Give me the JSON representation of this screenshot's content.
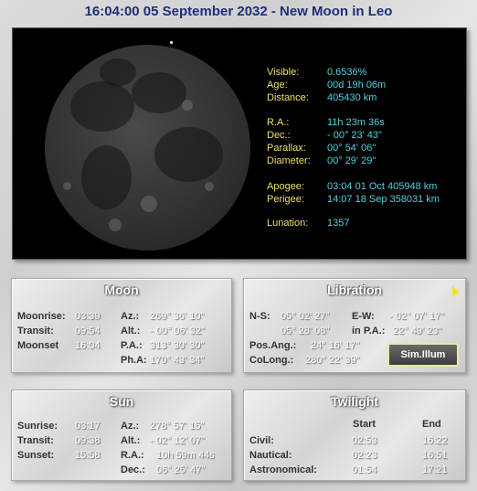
{
  "title": "16:04:00  05 September 2032 - New Moon in Leo",
  "info": [
    {
      "label": "Visible:",
      "value": "0.6536%"
    },
    {
      "label": "Age:",
      "value": "00d 19h 06m"
    },
    {
      "label": "Distance:",
      "value": "405430 km"
    },
    {
      "label": "R.A.:",
      "value": "11h 23m 36s"
    },
    {
      "label": "Dec.:",
      "value": "- 00° 23' 43\""
    },
    {
      "label": "Parallax:",
      "value": "00° 54' 06\""
    },
    {
      "label": "Diameter:",
      "value": "00° 29' 29\""
    },
    {
      "label": "Apogee:",
      "value": "03:04  01 Oct   405948 km"
    },
    {
      "label": "Perigee:",
      "value": "14:07  18 Sep  358031 km"
    },
    {
      "label": "Lunation:",
      "value": "1357"
    }
  ],
  "moon": {
    "title": "Moon",
    "left": [
      {
        "label": "Moonrise:",
        "value": "03:39"
      },
      {
        "label": "Transit:",
        "value": "09:54"
      },
      {
        "label": "Moonset",
        "value": "16:04"
      }
    ],
    "right": [
      {
        "label": "Az.:",
        "value": "269° 36' 10\""
      },
      {
        "label": "Alt.:",
        "value": "- 00° 06' 32\""
      },
      {
        "label": "P.A.:",
        "value": "313° 30' 30\""
      },
      {
        "label": "Ph.A:",
        "value": "170° 43' 34\""
      }
    ]
  },
  "libration": {
    "title": "Libration",
    "ns_label": "N-S:",
    "ns_value": "05° 02' 27\"",
    "ew_label": "E-W:",
    "ew_value": "- 02° 07' 17\"",
    "row2_value": "05° 28' 08\"",
    "inpa_label": "in P.A.:",
    "inpa_value": "22° 49' 23\"",
    "posang_label": "Pos.Ang.:",
    "posang_value": "24° 16' 17\"",
    "colong_label": "CoLong.:",
    "colong_value": "280° 22' 39\"",
    "button": "Sim.Illum"
  },
  "sun": {
    "title": "Sun",
    "left": [
      {
        "label": "Sunrise:",
        "value": "03:17"
      },
      {
        "label": "Transit:",
        "value": "09:38"
      },
      {
        "label": "Sunset:",
        "value": "15:58"
      }
    ],
    "right": [
      {
        "label": "Az.:",
        "value": "278° 57' 15\""
      },
      {
        "label": "Alt.:",
        "value": "- 02° 12' 07\""
      },
      {
        "label": "R.A.:",
        "value": "10h 59m 44s"
      },
      {
        "label": "Dec.:",
        "value": "06° 25' 47\""
      }
    ]
  },
  "twilight": {
    "title": "Twilight",
    "col_start": "Start",
    "col_end": "End",
    "rows": [
      {
        "label": "Civil:",
        "start": "02:53",
        "end": "16:22"
      },
      {
        "label": "Nautical:",
        "start": "02:23",
        "end": "16:51"
      },
      {
        "label": "Astronomical:",
        "start": "01:54",
        "end": "17:21"
      }
    ]
  }
}
